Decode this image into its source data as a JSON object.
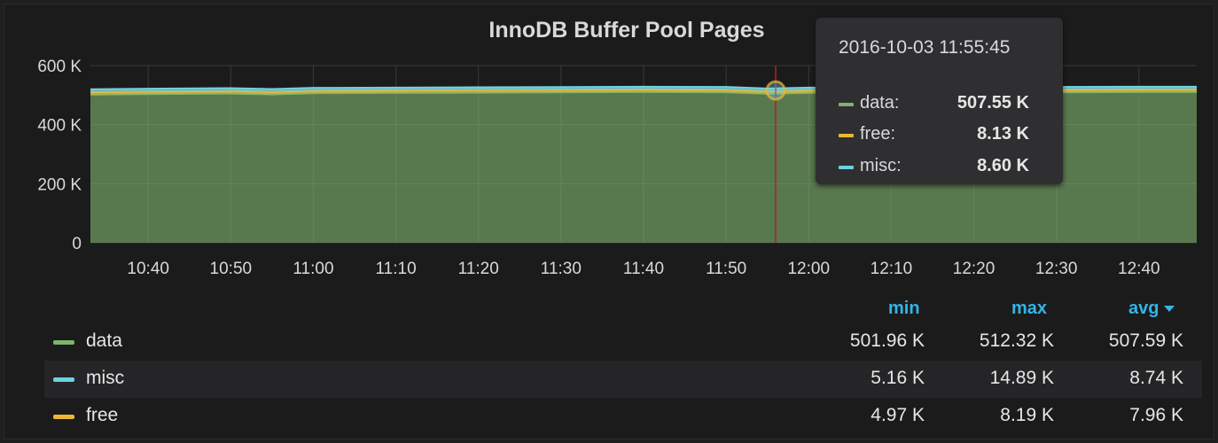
{
  "panel": {
    "title": "InnoDB Buffer Pool Pages"
  },
  "colors": {
    "data": "#7eb26d",
    "misc": "#6ed0e0",
    "free": "#eab839",
    "cursor": "#b22222",
    "accent": "#33b5e5"
  },
  "chart_data": {
    "type": "area",
    "title": "InnoDB Buffer Pool Pages",
    "stacked": true,
    "x_range": [
      "10:33",
      "12:47"
    ],
    "x_ticks": [
      "10:40",
      "10:50",
      "11:00",
      "11:10",
      "11:20",
      "11:30",
      "11:40",
      "11:50",
      "12:00",
      "12:10",
      "12:20",
      "12:30",
      "12:40"
    ],
    "y_ticks": [
      "0",
      "200 K",
      "400 K",
      "600 K"
    ],
    "ylim": [
      0,
      600000
    ],
    "grid": true,
    "series": [
      {
        "name": "data",
        "color": "#7eb26d",
        "x": [
          "10:33",
          "10:40",
          "10:50",
          "10:55",
          "11:00",
          "11:10",
          "11:20",
          "11:30",
          "11:40",
          "11:50",
          "11:55",
          "12:00",
          "12:10",
          "12:20",
          "12:30",
          "12:40",
          "12:47"
        ],
        "values": [
          502000,
          504000,
          506000,
          503000,
          507000,
          508000,
          509000,
          510000,
          511000,
          510000,
          505000,
          508000,
          509000,
          510000,
          510000,
          511000,
          511000
        ]
      },
      {
        "name": "free",
        "color": "#eab839",
        "x": [
          "10:33",
          "10:40",
          "10:50",
          "10:55",
          "11:00",
          "11:10",
          "11:20",
          "11:30",
          "11:40",
          "11:50",
          "11:55",
          "12:00",
          "12:10",
          "12:20",
          "12:30",
          "12:40",
          "12:47"
        ],
        "values": [
          8000,
          8000,
          8000,
          7900,
          8000,
          8000,
          8000,
          8000,
          8000,
          8000,
          8100,
          8000,
          8000,
          8000,
          8000,
          8000,
          8000
        ]
      },
      {
        "name": "misc",
        "color": "#6ed0e0",
        "x": [
          "10:33",
          "10:40",
          "10:50",
          "10:55",
          "11:00",
          "11:10",
          "11:20",
          "11:30",
          "11:40",
          "11:50",
          "11:55",
          "12:00",
          "12:10",
          "12:20",
          "12:30",
          "12:40",
          "12:47"
        ],
        "values": [
          9000,
          9000,
          8800,
          9000,
          8700,
          8700,
          8700,
          8600,
          8600,
          8700,
          8600,
          8700,
          8700,
          8700,
          8700,
          8700,
          8700
        ]
      }
    ],
    "cursor_time": "11:56"
  },
  "tooltip": {
    "time": "2016-10-03 11:55:45",
    "rows": [
      {
        "name": "data:",
        "value": "507.55 K",
        "color": "#7eb26d"
      },
      {
        "name": "free:",
        "value": "8.13 K",
        "color": "#eab839"
      },
      {
        "name": "misc:",
        "value": "8.60 K",
        "color": "#6ed0e0"
      }
    ]
  },
  "legend": {
    "headers": {
      "min": "min",
      "max": "max",
      "avg": "avg"
    },
    "rows": [
      {
        "name": "data",
        "color": "#7eb26d",
        "min": "501.96 K",
        "max": "512.32 K",
        "avg": "507.59 K"
      },
      {
        "name": "misc",
        "color": "#6ed0e0",
        "min": "5.16 K",
        "max": "14.89 K",
        "avg": "8.74 K"
      },
      {
        "name": "free",
        "color": "#eab839",
        "min": "4.97 K",
        "max": "8.19 K",
        "avg": "7.96 K"
      }
    ]
  }
}
